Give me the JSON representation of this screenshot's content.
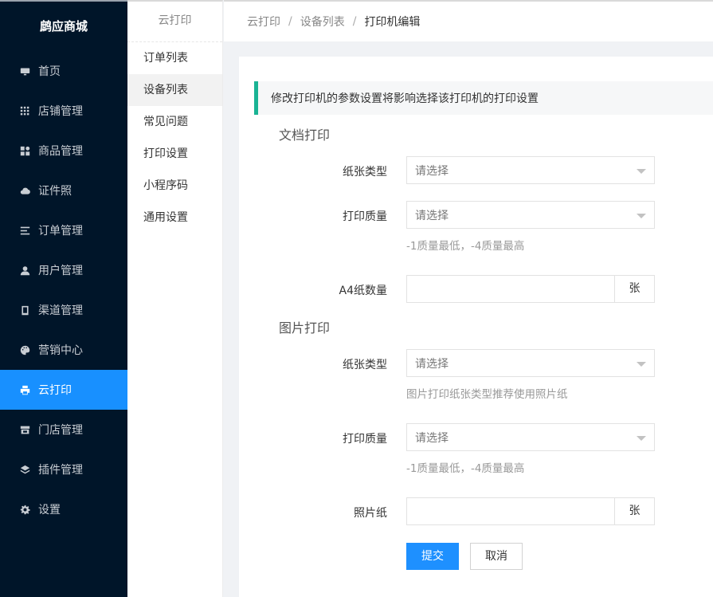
{
  "app": {
    "title": "鹧应商城"
  },
  "sidebar": {
    "items": [
      {
        "label": "首页",
        "icon": "monitor-icon"
      },
      {
        "label": "店铺管理",
        "icon": "grid-icon"
      },
      {
        "label": "商品管理",
        "icon": "apps-icon"
      },
      {
        "label": "证件照",
        "icon": "cloud-icon"
      },
      {
        "label": "订单管理",
        "icon": "list-icon"
      },
      {
        "label": "用户管理",
        "icon": "user-icon"
      },
      {
        "label": "渠道管理",
        "icon": "tablet-icon"
      },
      {
        "label": "营销中心",
        "icon": "palette-icon"
      },
      {
        "label": "云打印",
        "icon": "printer-icon",
        "active": true
      },
      {
        "label": "门店管理",
        "icon": "store-icon"
      },
      {
        "label": "插件管理",
        "icon": "layers-icon"
      },
      {
        "label": "设置",
        "icon": "gear-icon"
      }
    ]
  },
  "subnav": {
    "title": "云打印",
    "items": [
      {
        "label": "订单列表"
      },
      {
        "label": "设备列表",
        "active": true
      },
      {
        "label": "常见问题"
      },
      {
        "label": "打印设置"
      },
      {
        "label": "小程序码"
      },
      {
        "label": "通用设置"
      }
    ]
  },
  "breadcrumb": {
    "items": [
      "云打印",
      "设备列表",
      "打印机编辑"
    ],
    "separator": "/"
  },
  "form": {
    "notice": "修改打印机的参数设置将影响选择该打印机的打印设置",
    "doc_section": {
      "title": "文档打印",
      "paper_type": {
        "label": "纸张类型",
        "value": "请选择"
      },
      "quality": {
        "label": "打印质量",
        "value": "请选择",
        "help": "-1质量最低，-4质量最高"
      },
      "a4_count": {
        "label": "A4纸数量",
        "value": "",
        "unit": "张"
      }
    },
    "photo_section": {
      "title": "图片打印",
      "paper_type": {
        "label": "纸张类型",
        "value": "请选择",
        "help": "图片打印纸张类型推荐使用照片纸"
      },
      "quality": {
        "label": "打印质量",
        "value": "请选择",
        "help": "-1质量最低，-4质量最高"
      },
      "photo_paper": {
        "label": "照片纸",
        "value": "",
        "unit": "张"
      }
    },
    "submit_label": "提交",
    "cancel_label": "取消"
  },
  "colors": {
    "sidebar_bg": "#001529",
    "active": "#1890ff",
    "notice_accent": "#1ab394",
    "primary_button": "#1e90ff"
  }
}
